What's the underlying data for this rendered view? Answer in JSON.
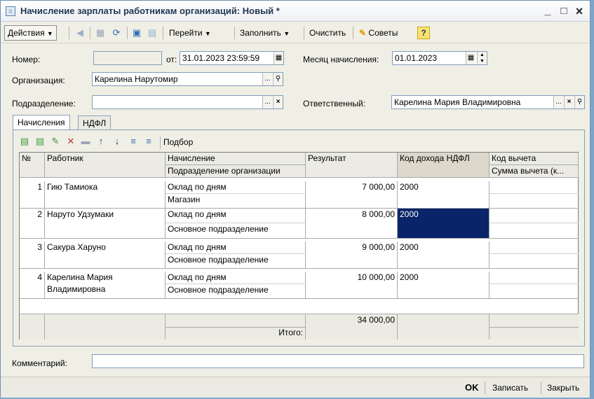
{
  "window": {
    "title": "Начисление зарплаты работникам организаций: Новый *",
    "title_icon": "=",
    "minimize": "_",
    "maximize": "□",
    "close": "×"
  },
  "toolbar": {
    "actions": "Действия",
    "goto": "Перейти",
    "fill": "Заполнить",
    "clear": "Очистить",
    "tips": "Советы",
    "help": "?"
  },
  "form": {
    "number_label": "Номер:",
    "number_value": "",
    "date_label": "от:",
    "date_value": "31.01.2023 23:59:59",
    "month_label": "Месяц начисления:",
    "month_value": "01.01.2023",
    "org_label": "Организация:",
    "org_value": "Карелина Нарутомир",
    "dept_label": "Подразделение:",
    "dept_value": "",
    "resp_label": "Ответственный:",
    "resp_value": "Карелина Мария Владимировна"
  },
  "tabs": [
    "Начисления",
    "НДФЛ"
  ],
  "table_toolbar": {
    "select_label": "Подбор"
  },
  "table": {
    "headers": {
      "no": "№",
      "employee": "Работник",
      "accrual": "Начисление",
      "dept": "Подразделение организации",
      "result": "Результат",
      "income_code": "Код дохода НДФЛ",
      "deduction_code": "Код вычета",
      "deduction_sum": "Сумма вычета (к..."
    },
    "rows": [
      {
        "no": "1",
        "employee": "Гию Тамиока",
        "accrual": "Оклад по дням",
        "dept": "Магазин",
        "result": "7 000,00",
        "income_code": "2000"
      },
      {
        "no": "2",
        "employee": "Наруто Удзумаки",
        "accrual": "Оклад по дням",
        "dept": "Основное подразделение",
        "result": "8 000,00",
        "income_code": "2000"
      },
      {
        "no": "3",
        "employee": "Сакура Харуно",
        "accrual": "Оклад по дням",
        "dept": "Основное подразделение",
        "result": "9 000,00",
        "income_code": "2000"
      },
      {
        "no": "4",
        "employee": "Карелина Мария Владимировна",
        "accrual": "Оклад по дням",
        "dept": "Основное подразделение",
        "result": "10 000,00",
        "income_code": "2000"
      }
    ],
    "total_label": "Итого:",
    "total_value": "34 000,00"
  },
  "comment": {
    "label": "Комментарий:",
    "value": ""
  },
  "bottom": {
    "ok": "OK",
    "save": "Записать",
    "close": "Закрыть"
  },
  "colors": {
    "selected_cell": "#0a246a",
    "accent_yellow": "#f3c214"
  }
}
